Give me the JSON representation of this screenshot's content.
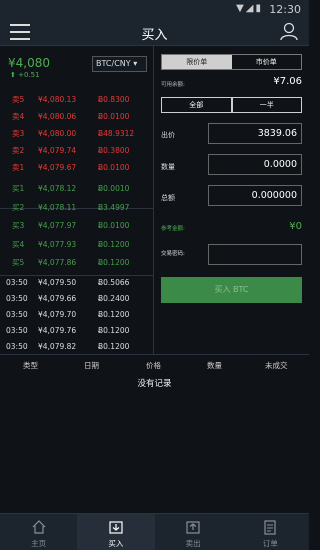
{
  "status": {
    "time": "12:30"
  },
  "header": {
    "title": "买入"
  },
  "ticker": {
    "price": "¥4,080",
    "change": "+0.51",
    "pair": "BTC/CNY"
  },
  "sells": [
    {
      "label": "卖5",
      "price": "¥4,080.13",
      "amount": "Ƀ0.8300"
    },
    {
      "label": "卖4",
      "price": "¥4,080.06",
      "amount": "Ƀ0.0100"
    },
    {
      "label": "卖3",
      "price": "¥4,080.00",
      "amount": "Ƀ48.9312"
    },
    {
      "label": "卖2",
      "price": "¥4,079.74",
      "amount": "Ƀ0.3800"
    },
    {
      "label": "卖1",
      "price": "¥4,079.67",
      "amount": "Ƀ0.0100"
    }
  ],
  "buys": [
    {
      "label": "买1",
      "price": "¥4,078.12",
      "amount": "Ƀ0.0010"
    },
    {
      "label": "买2",
      "price": "¥4,078.11",
      "amount": "Ƀ3.4997"
    },
    {
      "label": "买3",
      "price": "¥4,077.97",
      "amount": "Ƀ0.0100"
    },
    {
      "label": "买4",
      "price": "¥4,077.93",
      "amount": "Ƀ0.1200"
    },
    {
      "label": "买5",
      "price": "¥4,077.86",
      "amount": "Ƀ0.1200"
    }
  ],
  "trades": [
    {
      "time": "03:50",
      "price": "¥4,079.50",
      "amount": "Ƀ0.5066"
    },
    {
      "time": "03:50",
      "price": "¥4,079.66",
      "amount": "Ƀ0.2400"
    },
    {
      "time": "03:50",
      "price": "¥4,079.70",
      "amount": "Ƀ0.1200"
    },
    {
      "time": "03:50",
      "price": "¥4,079.76",
      "amount": "Ƀ0.1200"
    },
    {
      "time": "03:50",
      "price": "¥4,079.82",
      "amount": "Ƀ0.1200"
    }
  ],
  "form": {
    "tab_limit": "限价单",
    "tab_market": "市价单",
    "available_label": "可用余额:",
    "available_value": "¥7.06",
    "btn_all": "全部",
    "btn_half": "一半",
    "price_label": "出价",
    "price_value": "3839.06",
    "qty_label": "数量",
    "qty_value": "0.0000",
    "total_label": "总额",
    "total_value": "0.000000",
    "ref_label": "参考金额:",
    "ref_value": "¥0",
    "pwd_label": "交易密码:",
    "submit_label": "买入 BTC"
  },
  "orders": {
    "columns": [
      "类型",
      "日期",
      "价格",
      "数量",
      "未成交"
    ],
    "empty": "没有记录"
  },
  "tabbar": [
    {
      "label": "主页",
      "icon": "home-icon"
    },
    {
      "label": "买入",
      "icon": "buy-icon"
    },
    {
      "label": "卖出",
      "icon": "sell-icon"
    },
    {
      "label": "订单",
      "icon": "orders-icon"
    }
  ]
}
